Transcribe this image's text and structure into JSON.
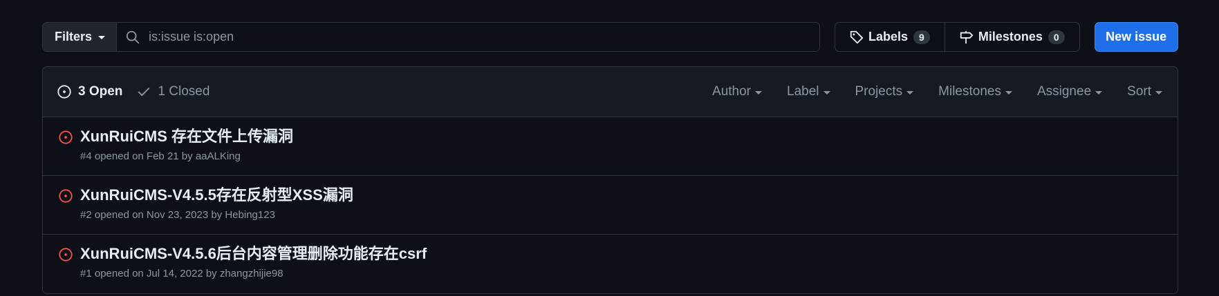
{
  "toolbar": {
    "filters_label": "Filters",
    "search_value": "is:issue is:open",
    "labels": {
      "label": "Labels",
      "count": "9"
    },
    "milestones": {
      "label": "Milestones",
      "count": "0"
    },
    "new_issue_label": "New issue"
  },
  "header": {
    "open_label": "3 Open",
    "closed_label": "1 Closed",
    "filters": [
      "Author",
      "Label",
      "Projects",
      "Milestones",
      "Assignee",
      "Sort"
    ]
  },
  "issues": [
    {
      "title": "XunRuiCMS 存在文件上传漏洞",
      "meta_prefix": "#4 opened on Feb 21 by ",
      "author": "aaALKing"
    },
    {
      "title": "XunRuiCMS-V4.5.5存在反射型XSS漏洞",
      "meta_prefix": "#2 opened on Nov 23, 2023 by ",
      "author": "Hebing123"
    },
    {
      "title": "XunRuiCMS-V4.5.6后台内容管理删除功能存在csrf",
      "meta_prefix": "#1 opened on Jul 14, 2022 by ",
      "author": "zhangzhijie98"
    }
  ],
  "icons": {
    "search": "search-icon",
    "label": "tag-icon",
    "milestone": "milestone-icon",
    "open": "issue-opened-icon",
    "closed": "check-icon"
  },
  "colors": {
    "background": "#0d1117",
    "accent": "#1f6feb",
    "open_issue": "#f85149",
    "muted_text": "#8d96a0"
  }
}
